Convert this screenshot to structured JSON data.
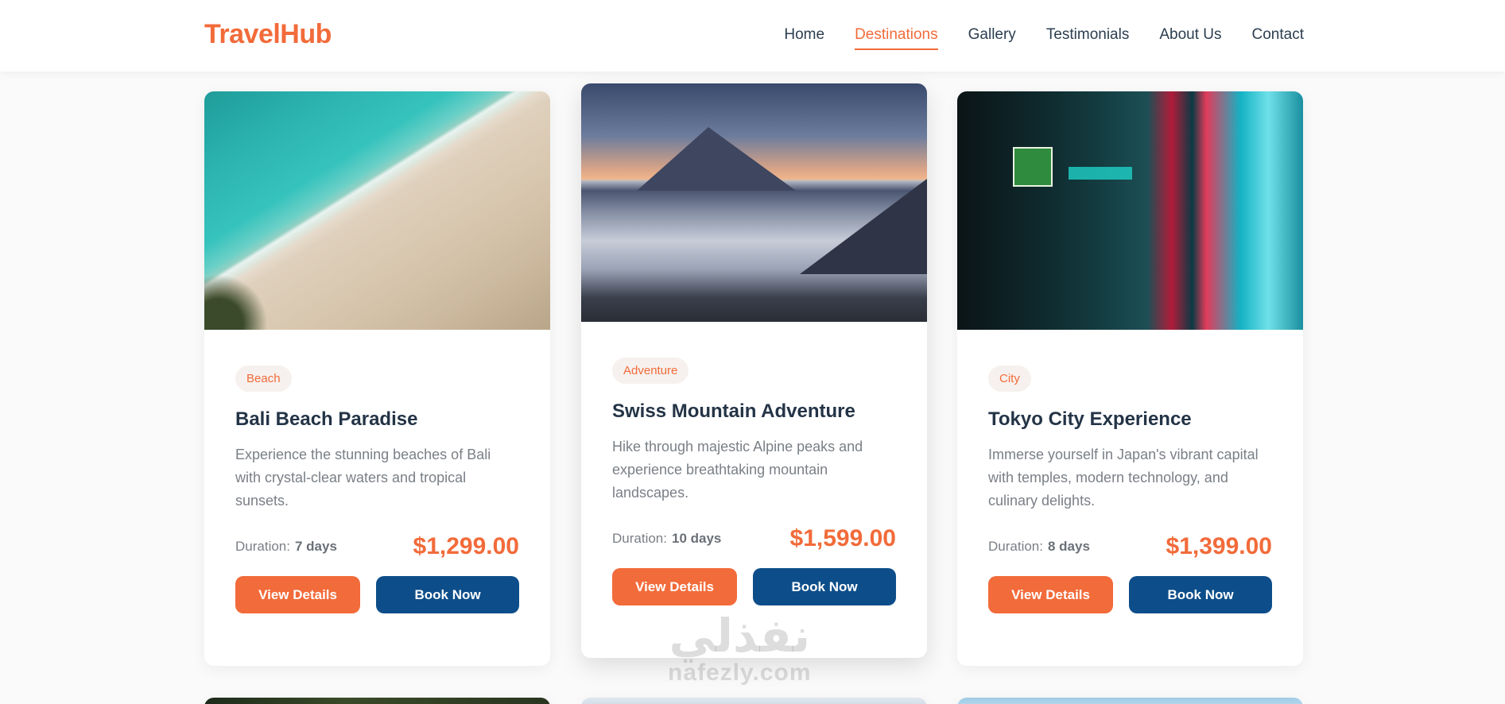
{
  "header": {
    "logo": "TravelHub",
    "nav": [
      {
        "label": "Home",
        "active": false
      },
      {
        "label": "Destinations",
        "active": true
      },
      {
        "label": "Gallery",
        "active": false
      },
      {
        "label": "Testimonials",
        "active": false
      },
      {
        "label": "About Us",
        "active": false
      },
      {
        "label": "Contact",
        "active": false
      }
    ]
  },
  "cards": [
    {
      "tag": "Beach",
      "title": "Bali Beach Paradise",
      "description": "Experience the stunning beaches of Bali with crystal-clear waters and tropical sunsets.",
      "duration_label": "Duration:",
      "duration": "7 days",
      "price": "$1,299.00",
      "details_label": "View Details",
      "book_label": "Book Now"
    },
    {
      "tag": "Adventure",
      "title": "Swiss Mountain Adventure",
      "description": "Hike through majestic Alpine peaks and experience breathtaking mountain landscapes.",
      "duration_label": "Duration:",
      "duration": "10 days",
      "price": "$1,599.00",
      "details_label": "View Details",
      "book_label": "Book Now"
    },
    {
      "tag": "City",
      "title": "Tokyo City Experience",
      "description": "Immerse yourself in Japan's vibrant capital with temples, modern technology, and culinary delights.",
      "duration_label": "Duration:",
      "duration": "8 days",
      "price": "$1,399.00",
      "details_label": "View Details",
      "book_label": "Book Now"
    }
  ],
  "watermark": {
    "arabic": "نفذلي",
    "latin": "nafezly.com"
  },
  "colors": {
    "accent": "#f26b3a",
    "primary": "#0d4e8a",
    "text": "#243447"
  }
}
